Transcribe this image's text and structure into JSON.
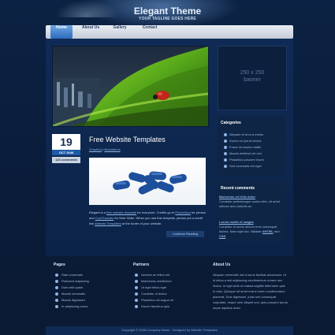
{
  "header": {
    "title": "Elegant Theme",
    "tagline": "YOUR TAGLINE GOES HERE"
  },
  "nav": {
    "items": [
      {
        "label": "Home"
      },
      {
        "label": "About Us"
      },
      {
        "label": "Gallery"
      },
      {
        "label": "Contact"
      }
    ]
  },
  "banner": {
    "line1": "250 x 250",
    "line2": "banner"
  },
  "post": {
    "day": "19",
    "month": "OCT 2048",
    "comments": "123 comments",
    "title": "Free Website Templates",
    "meta_link1": "Graphics",
    "meta_separator": "|",
    "meta_link2": "Illustrations",
    "text_lead": "Elegant is a ",
    "text_link1": "free website template",
    "text_mid1": " for everyone. Credits go to ",
    "text_link2": "PhotoVisor",
    "text_mid2": " for photos and ",
    "text_link3": "CoolTutorials",
    "text_mid3": " for Web Slider. When you use this template, please put a credit link ",
    "text_link4": "Website Templates",
    "text_end": " at the footer of your website.",
    "continue_label": "Continue Reading"
  },
  "categories": {
    "heading": "Categories",
    "items": [
      "Aliquam et arcu a metus",
      "Donec eu ipsum lectus",
      "Fusce id mauris mattis",
      "Mauris eleifend vel orci",
      "Phasellus posuere risum",
      "Sed venenatis est eget"
    ]
  },
  "recent_comments": {
    "heading": "Recent comments",
    "c1_title": "Maecenas vel felis dolor",
    "c1_text": "Curabitur pellentesque varius nibh, sit amet ultrices arcu lobortis ac.",
    "c2_title": "Lorem mollis et magna",
    "c2_text": "Curabitur et lorem dictum eros consequat lacinia. Nam eget dui. Validate ",
    "c2_link1": "XHTML",
    "c2_and": " and ",
    "c2_link2": "CSS"
  },
  "footer": {
    "pages_heading": "Pages",
    "pages": [
      "Start commads",
      "Praesent adipiscing",
      "Duis velit quam",
      "Mauris venenatis",
      "Mauris dignissim",
      "In adipiscing purus"
    ],
    "partners_heading": "Partners",
    "partners": [
      "Aenean ac tellus est",
      "Maecenas vestibulum",
      "Ut eget tellus eget",
      "Curabitur ut lectus",
      "Phasellus vel augue mi",
      "Donec faucibus quis"
    ],
    "about_heading": "About Us",
    "about_text": "Aliquam venenatis nisl a lacus facilisis accumsan. Ut id tellus a nisl adipiscing condimentum ornare nec lectus. In eget ante ut massa sagittis bibendum quis in odio. Quisque sit amet erat a lorem condimentum placerat. Duis dignissim, justo sed consequat vulputate, neque sem aliquet orci, quis posuere purus turpis dapibus dolor."
  },
  "copyright": {
    "text": "Copyright © 2048 Company Name - Designed by Website Templates"
  },
  "colors": {
    "background": "#0a1a33",
    "container": "#0f2b55",
    "accent": "#2d6bbd",
    "link": "#8fb5e6"
  }
}
